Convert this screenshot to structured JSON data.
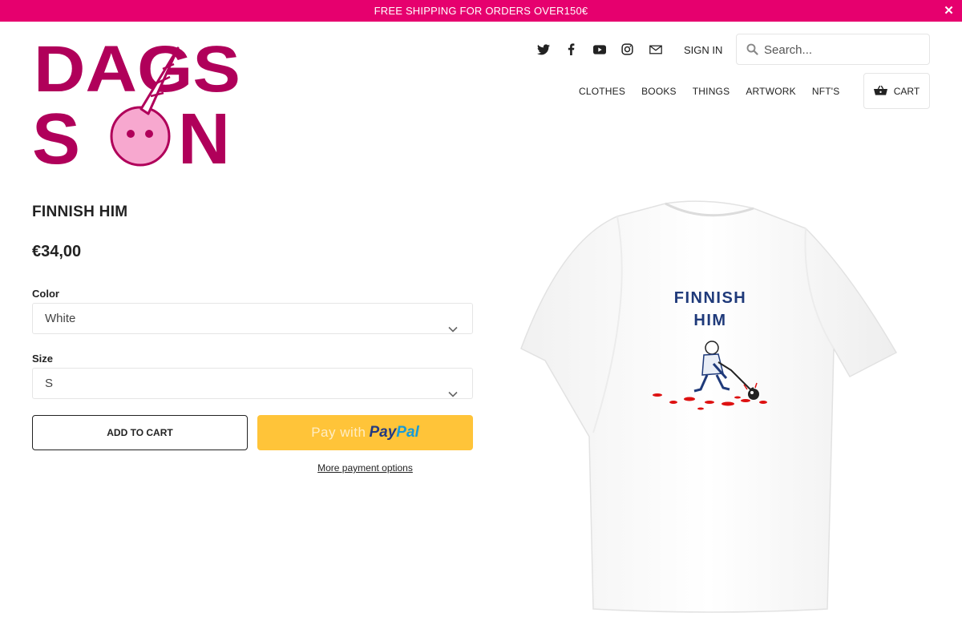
{
  "announcement": {
    "text": "FREE SHIPPING FOR ORDERS OVER150€",
    "close": "✕"
  },
  "brand": {
    "logo_top": "DAGS",
    "logo_bottom_1": "S",
    "logo_bottom_2": "N",
    "color": "#b0005a",
    "accent": "#e6006e"
  },
  "header": {
    "social_icons": [
      "twitter-icon",
      "facebook-icon",
      "youtube-icon",
      "instagram-icon",
      "email-icon"
    ],
    "sign_in": "SIGN IN",
    "search": {
      "placeholder": "Search..."
    },
    "nav": [
      "CLOTHES",
      "BOOKS",
      "THINGS",
      "ARTWORK",
      "NFT'S"
    ],
    "cart": "CART"
  },
  "product": {
    "title": "FINNISH HIM",
    "price": "€34,00",
    "color_label": "Color",
    "color_value": "White",
    "size_label": "Size",
    "size_value": "S",
    "add_to_cart": "ADD TO CART",
    "paypal_pay": "Pay with",
    "paypal_brand_1": "Pay",
    "paypal_brand_2": "Pal",
    "more_payment": "More payment options",
    "shirt_print_line1": "FINNISH",
    "shirt_print_line2": "HIM"
  }
}
